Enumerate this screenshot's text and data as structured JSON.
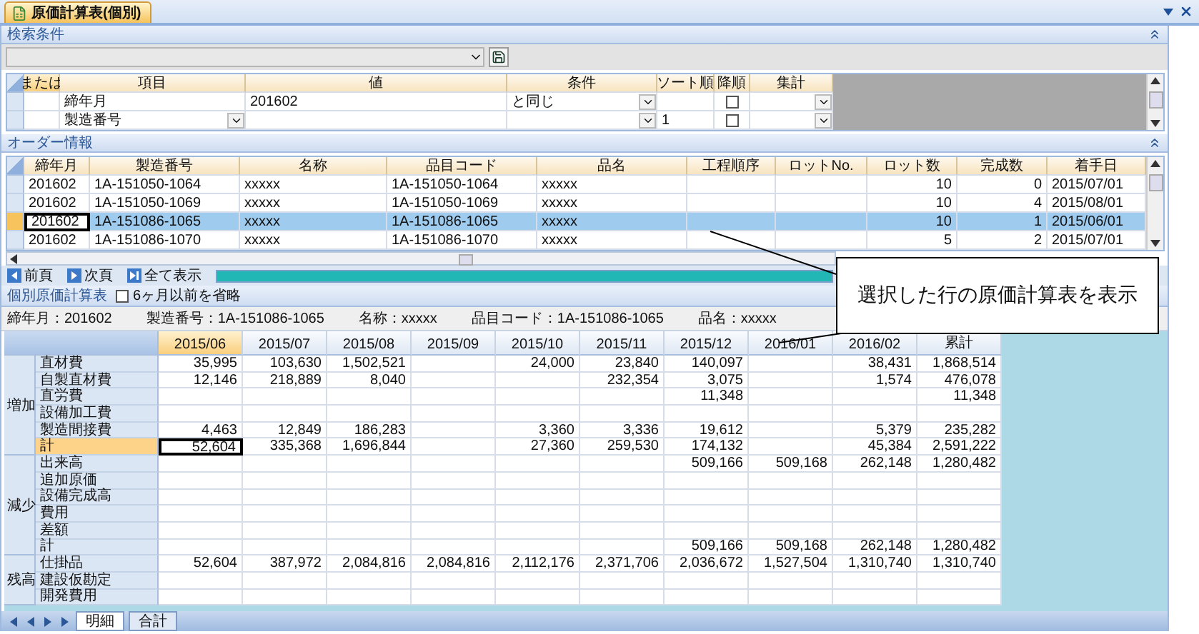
{
  "document_tab": {
    "title": "原価計算表(個別)",
    "selected": true
  },
  "search": {
    "title": "検索条件",
    "columns": [
      "または",
      "項目",
      "値",
      "条件",
      "ソート順",
      "降順",
      "集計"
    ],
    "rows": [
      {
        "item": "締年月",
        "item_has_dropdown": false,
        "value": "201602",
        "condition": "と同じ",
        "descending": false
      },
      {
        "item": "製造番号",
        "item_has_dropdown": true,
        "sort_order": "1",
        "descending": false
      }
    ]
  },
  "orders": {
    "title": "オーダー情報",
    "columns": [
      "締年月",
      "製造番号",
      "名称",
      "品目コード",
      "品名",
      "工程順序",
      "ロットNo.",
      "ロット数",
      "完成数",
      "着手日"
    ],
    "rows": [
      {
        "selected": false,
        "closing_month": "201602",
        "serial_no": "1A-151050-1064",
        "name": "xxxxx",
        "item_code": "1A-151050-1064",
        "item_name": "xxxxx",
        "lot_count": "10",
        "completed": "0",
        "start_date": "2015/07/01"
      },
      {
        "selected": false,
        "closing_month": "201602",
        "serial_no": "1A-151050-1069",
        "name": "xxxxx",
        "item_code": "1A-151050-1069",
        "item_name": "xxxxx",
        "lot_count": "10",
        "completed": "4",
        "start_date": "2015/08/01"
      },
      {
        "selected": true,
        "closing_month": "201602",
        "serial_no": "1A-151086-1065",
        "name": "xxxxx",
        "item_code": "1A-151086-1065",
        "item_name": "xxxxx",
        "lot_count": "10",
        "completed": "1",
        "start_date": "2015/06/01"
      },
      {
        "selected": false,
        "closing_month": "201602",
        "serial_no": "1A-151086-1070",
        "name": "xxxxx",
        "item_code": "1A-151086-1070",
        "item_name": "xxxxx",
        "lot_count": "5",
        "completed": "2",
        "start_date": "2015/07/01"
      }
    ]
  },
  "pager": [
    {
      "kind": "prev",
      "label": "前頁"
    },
    {
      "kind": "next",
      "label": "次頁"
    },
    {
      "kind": "all",
      "label": "全て表示"
    }
  ],
  "progress": {
    "level": 1
  },
  "cost": {
    "title": "個別原価計算表",
    "omit_option": {
      "label": "6ヶ月以前を省略",
      "checked": false
    },
    "info": [
      "締年月：201602",
      "製造番号：1A-151086-1065",
      "名称：xxxxx",
      "品目コード：1A-151086-1065",
      "品名：xxxxx"
    ],
    "columns": [
      {
        "label": "2015/06",
        "selected": true
      },
      {
        "label": "2015/07",
        "selected": false
      },
      {
        "label": "2015/08",
        "selected": false
      },
      {
        "label": "2015/09",
        "selected": false
      },
      {
        "label": "2015/10",
        "selected": false
      },
      {
        "label": "2015/11",
        "selected": false
      },
      {
        "label": "2015/12",
        "selected": false
      },
      {
        "label": "2016/01",
        "selected": false
      },
      {
        "label": "2016/02",
        "selected": false
      },
      {
        "label": "累計",
        "selected": false
      }
    ],
    "groups": [
      {
        "label": "増加",
        "rows": [
          {
            "label": "直材費",
            "selected": false,
            "values": [
              {
                "kind": "amount",
                "text": "35,995"
              },
              {
                "kind": "amount",
                "text": "103,630"
              },
              {
                "kind": "amount",
                "text": "1,502,521"
              },
              {
                "kind": "blank"
              },
              {
                "kind": "amount",
                "text": "24,000"
              },
              {
                "kind": "amount",
                "text": "23,840"
              },
              {
                "kind": "amount",
                "text": "140,097"
              },
              {
                "kind": "blank"
              },
              {
                "kind": "amount",
                "text": "38,431"
              },
              {
                "kind": "amount",
                "text": "1,868,514"
              }
            ]
          },
          {
            "label": "自製直材費",
            "selected": false,
            "values": [
              {
                "kind": "amount",
                "text": "12,146"
              },
              {
                "kind": "amount",
                "text": "218,889"
              },
              {
                "kind": "amount",
                "text": "8,040"
              },
              {
                "kind": "blank"
              },
              {
                "kind": "blank"
              },
              {
                "kind": "amount",
                "text": "232,354"
              },
              {
                "kind": "amount",
                "text": "3,075"
              },
              {
                "kind": "blank"
              },
              {
                "kind": "amount",
                "text": "1,574"
              },
              {
                "kind": "amount",
                "text": "476,078"
              }
            ]
          },
          {
            "label": "直労費",
            "selected": false,
            "values": [
              {
                "kind": "blank"
              },
              {
                "kind": "blank"
              },
              {
                "kind": "blank"
              },
              {
                "kind": "blank"
              },
              {
                "kind": "blank"
              },
              {
                "kind": "blank"
              },
              {
                "kind": "amount",
                "text": "11,348"
              },
              {
                "kind": "blank"
              },
              {
                "kind": "blank"
              },
              {
                "kind": "amount",
                "text": "11,348"
              }
            ]
          },
          {
            "label": "設備加工費",
            "selected": false,
            "values": [
              {
                "kind": "blank"
              },
              {
                "kind": "blank"
              },
              {
                "kind": "blank"
              },
              {
                "kind": "blank"
              },
              {
                "kind": "blank"
              },
              {
                "kind": "blank"
              },
              {
                "kind": "blank"
              },
              {
                "kind": "blank"
              },
              {
                "kind": "blank"
              },
              {
                "kind": "blank"
              }
            ]
          },
          {
            "label": "製造間接費",
            "selected": false,
            "values": [
              {
                "kind": "amount",
                "text": "4,463"
              },
              {
                "kind": "amount",
                "text": "12,849"
              },
              {
                "kind": "amount",
                "text": "186,283"
              },
              {
                "kind": "blank"
              },
              {
                "kind": "amount",
                "text": "3,360"
              },
              {
                "kind": "amount",
                "text": "3,336"
              },
              {
                "kind": "amount",
                "text": "19,612"
              },
              {
                "kind": "blank"
              },
              {
                "kind": "amount",
                "text": "5,379"
              },
              {
                "kind": "amount",
                "text": "235,282"
              }
            ]
          },
          {
            "label": "計",
            "selected": true,
            "values": [
              {
                "kind": "amount",
                "text": "52,604"
              },
              {
                "kind": "amount",
                "text": "335,368"
              },
              {
                "kind": "amount",
                "text": "1,696,844"
              },
              {
                "kind": "blank"
              },
              {
                "kind": "amount",
                "text": "27,360"
              },
              {
                "kind": "amount",
                "text": "259,530"
              },
              {
                "kind": "amount",
                "text": "174,132"
              },
              {
                "kind": "blank"
              },
              {
                "kind": "amount",
                "text": "45,384"
              },
              {
                "kind": "amount",
                "text": "2,591,222"
              }
            ]
          }
        ]
      },
      {
        "label": "減少",
        "rows": [
          {
            "label": "出来高",
            "selected": false,
            "values": [
              {
                "kind": "blank"
              },
              {
                "kind": "blank"
              },
              {
                "kind": "blank"
              },
              {
                "kind": "blank"
              },
              {
                "kind": "blank"
              },
              {
                "kind": "blank"
              },
              {
                "kind": "amount",
                "text": "509,166"
              },
              {
                "kind": "amount",
                "text": "509,168"
              },
              {
                "kind": "amount",
                "text": "262,148"
              },
              {
                "kind": "amount",
                "text": "1,280,482"
              }
            ]
          },
          {
            "label": "追加原価",
            "selected": false,
            "values": [
              {
                "kind": "blank"
              },
              {
                "kind": "blank"
              },
              {
                "kind": "blank"
              },
              {
                "kind": "blank"
              },
              {
                "kind": "blank"
              },
              {
                "kind": "blank"
              },
              {
                "kind": "blank"
              },
              {
                "kind": "blank"
              },
              {
                "kind": "blank"
              },
              {
                "kind": "blank"
              }
            ]
          },
          {
            "label": "設備完成高",
            "selected": false,
            "values": [
              {
                "kind": "blank"
              },
              {
                "kind": "blank"
              },
              {
                "kind": "blank"
              },
              {
                "kind": "blank"
              },
              {
                "kind": "blank"
              },
              {
                "kind": "blank"
              },
              {
                "kind": "blank"
              },
              {
                "kind": "blank"
              },
              {
                "kind": "blank"
              },
              {
                "kind": "blank"
              }
            ]
          },
          {
            "label": "費用",
            "selected": false,
            "values": [
              {
                "kind": "blank"
              },
              {
                "kind": "blank"
              },
              {
                "kind": "blank"
              },
              {
                "kind": "blank"
              },
              {
                "kind": "blank"
              },
              {
                "kind": "blank"
              },
              {
                "kind": "blank"
              },
              {
                "kind": "blank"
              },
              {
                "kind": "blank"
              },
              {
                "kind": "blank"
              }
            ]
          },
          {
            "label": "差額",
            "selected": false,
            "values": [
              {
                "kind": "blank"
              },
              {
                "kind": "blank"
              },
              {
                "kind": "blank"
              },
              {
                "kind": "blank"
              },
              {
                "kind": "blank"
              },
              {
                "kind": "blank"
              },
              {
                "kind": "blank"
              },
              {
                "kind": "blank"
              },
              {
                "kind": "blank"
              },
              {
                "kind": "blank"
              }
            ]
          },
          {
            "label": "計",
            "selected": false,
            "values": [
              {
                "kind": "blank"
              },
              {
                "kind": "blank"
              },
              {
                "kind": "blank"
              },
              {
                "kind": "blank"
              },
              {
                "kind": "blank"
              },
              {
                "kind": "blank"
              },
              {
                "kind": "amount",
                "text": "509,166"
              },
              {
                "kind": "amount",
                "text": "509,168"
              },
              {
                "kind": "amount",
                "text": "262,148"
              },
              {
                "kind": "amount",
                "text": "1,280,482"
              }
            ]
          }
        ]
      },
      {
        "label": "残高",
        "rows": [
          {
            "label": "仕掛品",
            "selected": false,
            "values": [
              {
                "kind": "amount",
                "text": "52,604"
              },
              {
                "kind": "amount",
                "text": "387,972"
              },
              {
                "kind": "amount",
                "text": "2,084,816"
              },
              {
                "kind": "amount",
                "text": "2,084,816"
              },
              {
                "kind": "amount",
                "text": "2,112,176"
              },
              {
                "kind": "amount",
                "text": "2,371,706"
              },
              {
                "kind": "amount",
                "text": "2,036,672"
              },
              {
                "kind": "amount",
                "text": "1,527,504"
              },
              {
                "kind": "amount",
                "text": "1,310,740"
              },
              {
                "kind": "amount",
                "text": "1,310,740"
              }
            ]
          },
          {
            "label": "建設仮勘定",
            "selected": false,
            "values": [
              {
                "kind": "blank"
              },
              {
                "kind": "blank"
              },
              {
                "kind": "blank"
              },
              {
                "kind": "blank"
              },
              {
                "kind": "blank"
              },
              {
                "kind": "blank"
              },
              {
                "kind": "blank"
              },
              {
                "kind": "blank"
              },
              {
                "kind": "blank"
              },
              {
                "kind": "blank"
              }
            ]
          },
          {
            "label": "開発費用",
            "selected": false,
            "values": [
              {
                "kind": "blank"
              },
              {
                "kind": "blank"
              },
              {
                "kind": "blank"
              },
              {
                "kind": "blank"
              },
              {
                "kind": "blank"
              },
              {
                "kind": "blank"
              },
              {
                "kind": "blank"
              },
              {
                "kind": "blank"
              },
              {
                "kind": "blank"
              },
              {
                "kind": "blank"
              }
            ]
          }
        ]
      }
    ]
  },
  "sheet_tabs": [
    {
      "label": "明細",
      "selected": true
    },
    {
      "label": "合計",
      "selected": false
    }
  ],
  "callout": {
    "text": "選択した行の原価計算表を表示"
  }
}
